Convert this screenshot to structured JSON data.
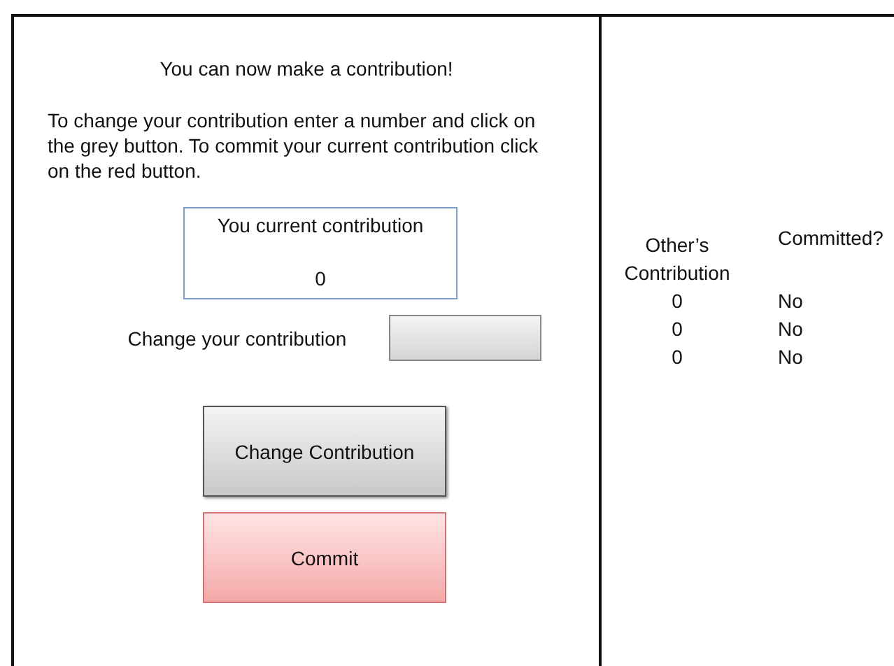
{
  "heading": "You can now make a contribution!",
  "instructions": "To change your contribution enter a number and click on the grey button. To commit your current contribution click on the red button.",
  "current_contribution": {
    "label": "You current contribution",
    "value": "0"
  },
  "change_field": {
    "label": "Change your contribution"
  },
  "buttons": [
    {
      "label": "Change Contribution",
      "kind": "grey"
    },
    {
      "label": "Commit",
      "kind": "red"
    }
  ],
  "others": {
    "columns": [
      "Other’s Contribution",
      "Committed?"
    ],
    "rows": [
      {
        "contribution": "0",
        "committed": "No"
      },
      {
        "contribution": "0",
        "committed": "No"
      },
      {
        "contribution": "0",
        "committed": "No"
      }
    ]
  }
}
